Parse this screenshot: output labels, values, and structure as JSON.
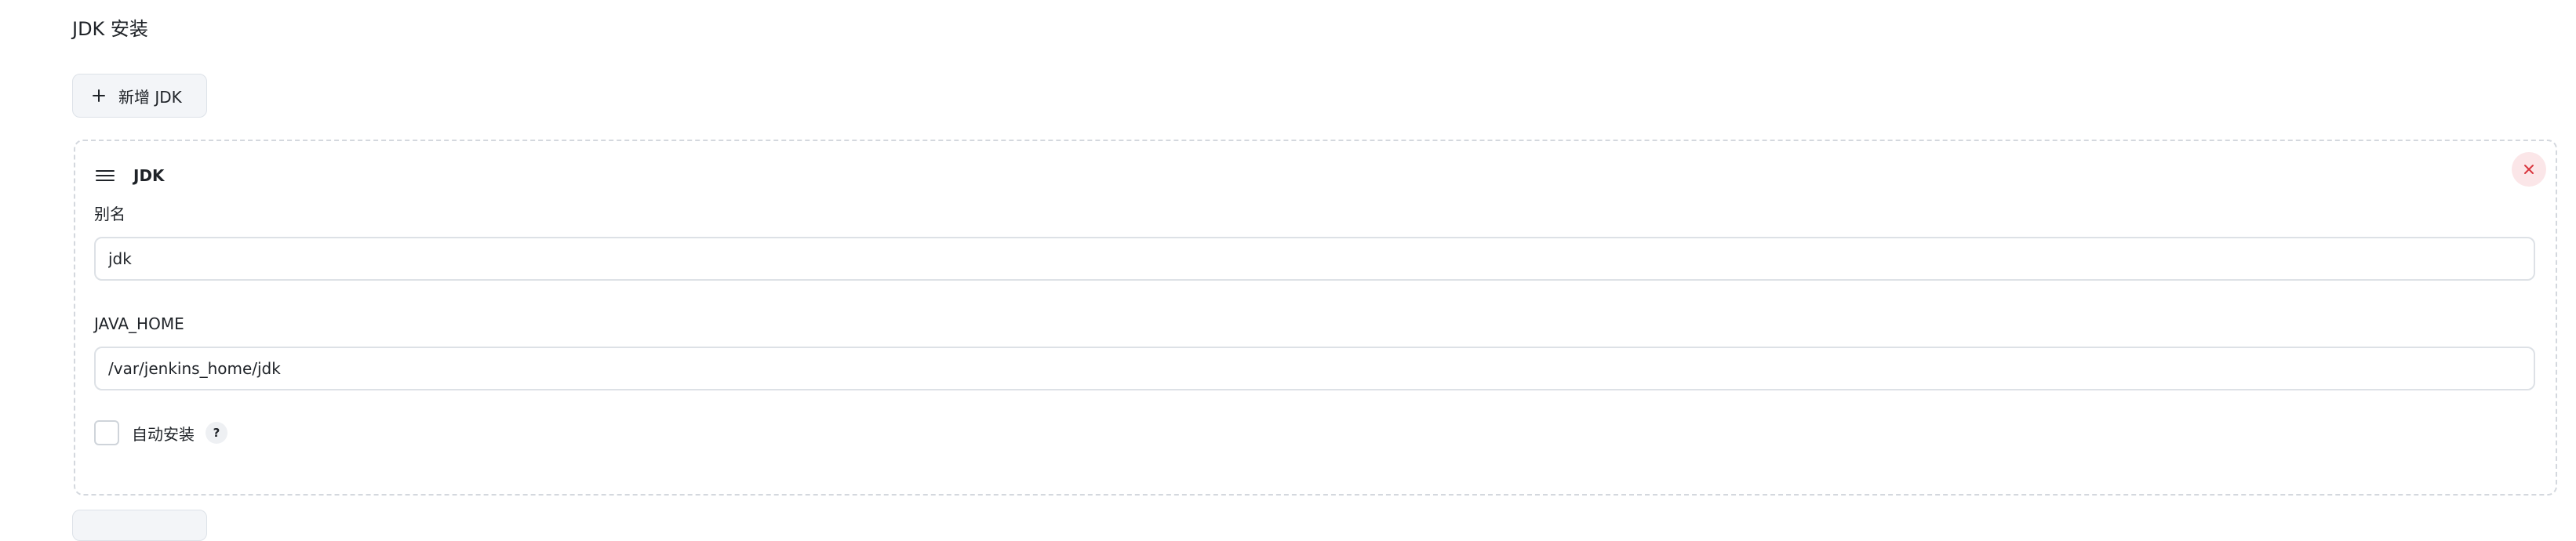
{
  "section": {
    "title": "JDK 安装"
  },
  "toolbar": {
    "add_label": "新增 JDK"
  },
  "jdk_card": {
    "title": "JDK",
    "alias": {
      "label": "别名",
      "value": "jdk"
    },
    "java_home": {
      "label": "JAVA_HOME",
      "value": "/var/jenkins_home/jdk"
    },
    "auto_install": {
      "label": "自动安装",
      "checked": false,
      "help": "?"
    }
  },
  "icons": {
    "add": "plus-icon",
    "drag": "drag-handle-icon",
    "delete": "close-icon",
    "help": "help-icon"
  },
  "colors": {
    "delete_bg": "#fbe6e8",
    "delete_icon": "#d9363e",
    "button_bg": "#f3f5f8"
  }
}
